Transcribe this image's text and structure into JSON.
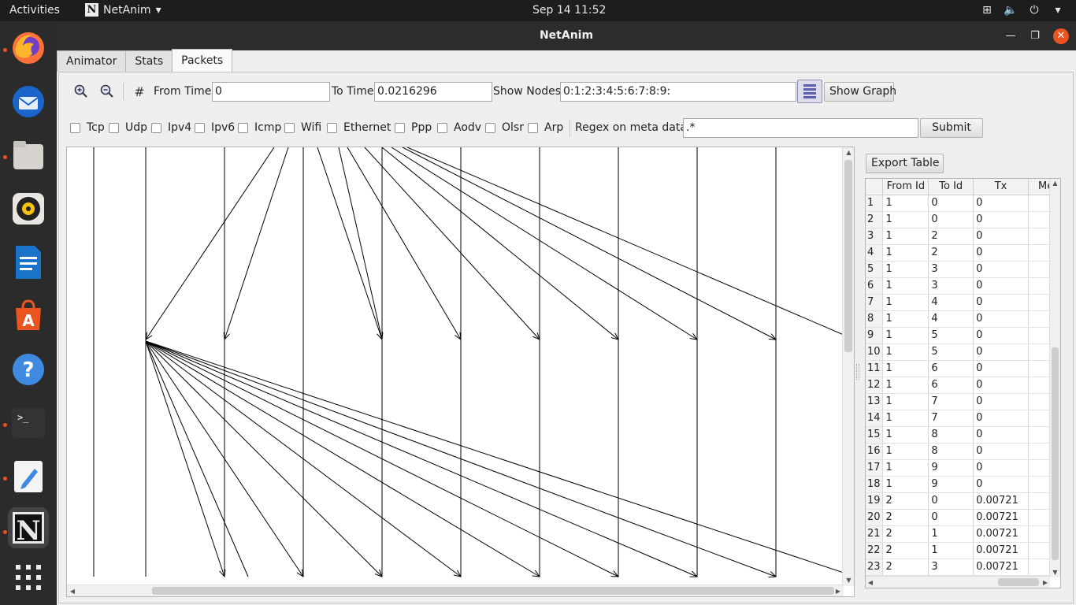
{
  "topbar": {
    "activities": "Activities",
    "app_name": "NetAnim",
    "app_icon_letter": "N",
    "clock": "Sep 14  11:52"
  },
  "window": {
    "title": "NetAnim"
  },
  "tabs": [
    {
      "label": "Animator"
    },
    {
      "label": "Stats"
    },
    {
      "label": "Packets",
      "active": true
    }
  ],
  "toolbar": {
    "from_time_label": "From Time",
    "from_time_value": "0",
    "to_time_label": "To Time",
    "to_time_value": "0.0216296",
    "show_nodes_label": "Show Nodes",
    "show_nodes_value": "0:1:2:3:4:5:6:7:8:9:",
    "show_graph_label": "Show Graph"
  },
  "filters": {
    "items": [
      "Tcp",
      "Udp",
      "Ipv4",
      "Ipv6",
      "Icmp",
      "Wifi",
      "Ethernet",
      "Ppp",
      "Aodv",
      "Olsr",
      "Arp"
    ],
    "regex_label": "Regex on meta data",
    "regex_value": ".*",
    "submit_label": "Submit"
  },
  "table": {
    "export_label": "Export Table",
    "columns": [
      "From Id",
      "To Id",
      "Tx",
      "Me"
    ],
    "rows": [
      [
        "1",
        "1",
        "0",
        "0"
      ],
      [
        "2",
        "1",
        "0",
        "0"
      ],
      [
        "3",
        "1",
        "2",
        "0"
      ],
      [
        "4",
        "1",
        "2",
        "0"
      ],
      [
        "5",
        "1",
        "3",
        "0"
      ],
      [
        "6",
        "1",
        "3",
        "0"
      ],
      [
        "7",
        "1",
        "4",
        "0"
      ],
      [
        "8",
        "1",
        "4",
        "0"
      ],
      [
        "9",
        "1",
        "5",
        "0"
      ],
      [
        "10",
        "1",
        "5",
        "0"
      ],
      [
        "11",
        "1",
        "6",
        "0"
      ],
      [
        "12",
        "1",
        "6",
        "0"
      ],
      [
        "13",
        "1",
        "7",
        "0"
      ],
      [
        "14",
        "1",
        "7",
        "0"
      ],
      [
        "15",
        "1",
        "8",
        "0"
      ],
      [
        "16",
        "1",
        "8",
        "0"
      ],
      [
        "17",
        "1",
        "9",
        "0"
      ],
      [
        "18",
        "1",
        "9",
        "0"
      ],
      [
        "19",
        "2",
        "0",
        "0.00721"
      ],
      [
        "20",
        "2",
        "0",
        "0.00721"
      ],
      [
        "21",
        "2",
        "1",
        "0.00721"
      ],
      [
        "22",
        "2",
        "1",
        "0.00721"
      ],
      [
        "23",
        "2",
        "3",
        "0.00721"
      ]
    ]
  },
  "dock": {
    "items": [
      {
        "icon": "firefox-icon",
        "running": true
      },
      {
        "icon": "thunderbird-icon",
        "running": false
      },
      {
        "icon": "files-icon",
        "running": true
      },
      {
        "icon": "rhythmbox-icon",
        "running": false
      },
      {
        "icon": "libreoffice-writer-icon",
        "running": false
      },
      {
        "icon": "ubuntu-software-icon",
        "running": false
      },
      {
        "icon": "help-icon",
        "running": false
      },
      {
        "icon": "terminal-icon",
        "running": true
      },
      {
        "icon": "text-editor-icon",
        "running": true
      },
      {
        "icon": "netanim-icon",
        "running": true
      },
      {
        "icon": "show-apps-icon",
        "running": false
      }
    ]
  },
  "colors": {
    "accent": "#e95420",
    "topbar": "#1d1d1d",
    "titlebar": "#2c2c2c"
  }
}
